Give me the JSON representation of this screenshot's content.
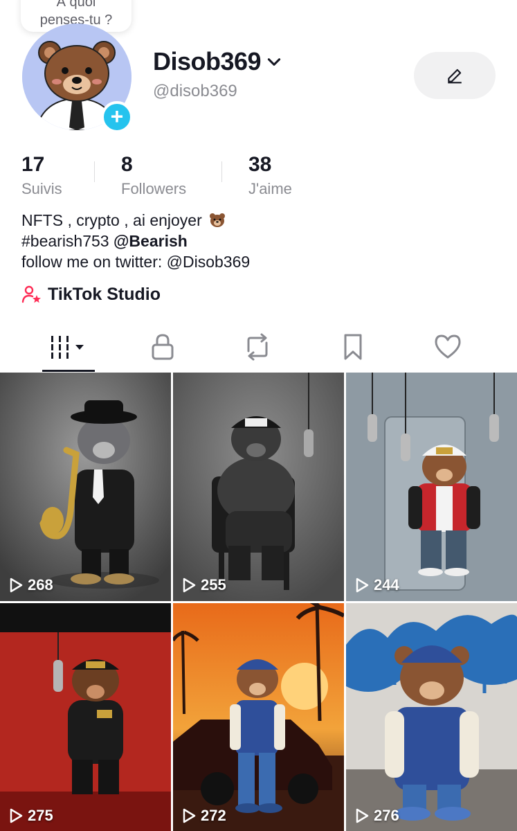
{
  "profile": {
    "bubble_line1": "À quoi",
    "bubble_line2": "penses-tu ?",
    "username": "Disob369",
    "handle": "@disob369"
  },
  "stats": [
    {
      "value": "17",
      "label": "Suivis"
    },
    {
      "value": "8",
      "label": "Followers"
    },
    {
      "value": "38",
      "label": "J'aime"
    }
  ],
  "bio": {
    "line1": "NFTS , crypto , ai enjoyer",
    "line2_tag": "#bearish753",
    "line2_mention": "@Bearish",
    "line3": "follow me on twitter: @Disob369"
  },
  "studio": {
    "label": "TikTok Studio"
  },
  "tabs": [
    {
      "icon": "videos-grid-icon",
      "active": true
    },
    {
      "icon": "lock-icon",
      "active": false
    },
    {
      "icon": "repost-icon",
      "active": false
    },
    {
      "icon": "bookmark-icon",
      "active": false
    },
    {
      "icon": "heart-icon",
      "active": false
    }
  ],
  "videos": [
    {
      "views": "268"
    },
    {
      "views": "255"
    },
    {
      "views": "244"
    },
    {
      "views": "275"
    },
    {
      "views": "272"
    },
    {
      "views": "276"
    }
  ],
  "colors": {
    "accent_pink": "#fe2c55",
    "badge_blue": "#25c3ee",
    "text_primary": "#161823",
    "text_secondary": "#8a8b91"
  }
}
